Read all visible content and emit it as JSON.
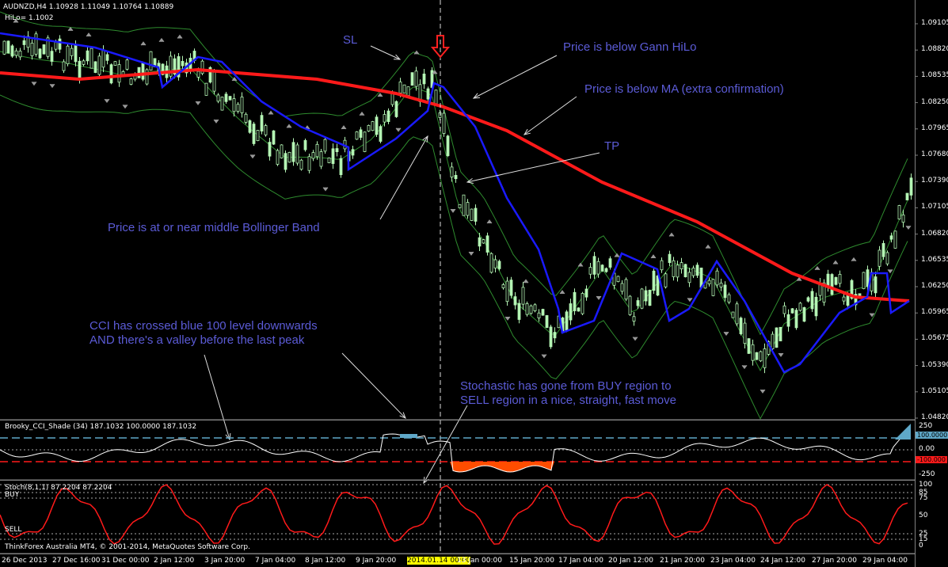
{
  "header": {
    "symbol_info": "AUDNZD,H4  1.10928 1.11049 1.10764 1.10889",
    "hilo_label": "HiLo= 1.1002"
  },
  "annotations": {
    "sl": "SL",
    "gann": "Price is below Gann HiLo",
    "ma": "Price is below MA (extra confirmation)",
    "tp": "TP",
    "bollinger": "Price is at or near middle Bollinger Band",
    "cci_line1": "CCI has crossed blue 100 level downwards",
    "cci_line2": "AND there's a valley before the last peak",
    "stoch_line1": "Stochastic has gone from BUY region to",
    "stoch_line2": "SELL region in a nice, straight, fast move"
  },
  "price_axis": [
    "1.09105",
    "1.08820",
    "1.08535",
    "1.08250",
    "1.07965",
    "1.07680",
    "1.07390",
    "1.07105",
    "1.06820",
    "1.06535",
    "1.06250",
    "1.05965",
    "1.05675",
    "1.05390",
    "1.05105",
    "1.04820"
  ],
  "cci": {
    "label": "Brooky_CCI_Shade (34) 187.1032 100.0000 187.1032",
    "axis": [
      "250",
      "0.00",
      "-250"
    ],
    "badge_upper": "100.0000",
    "badge_lower": "-100.000"
  },
  "stoch": {
    "label": "Stoch(8,1,1) 87.2204 87.2204",
    "buy": "BUY",
    "sell": "SELL",
    "axis": [
      "100",
      "85",
      "75",
      "50",
      "25",
      "15",
      "0"
    ]
  },
  "footer": {
    "copyright": "ThinkForex Australia MT4, © 2001-2014, MetaQuotes Software Corp."
  },
  "time_axis": [
    "26 Dec 2013",
    "27 Dec 16:00",
    "31 Dec 00:00",
    "2 Jan 12:00",
    "3 Jan 20:00",
    "7 Jan 04:00",
    "8 Jan 12:00",
    "9 Jan 20:00",
    "2014.01.14 00:00",
    "13 Jan 00:00",
    "15 Jan 20:00",
    "17 Jan 04:00",
    "20 Jan 12:00",
    "21 Jan 20:00",
    "23 Jan 04:00",
    "24 Jan 12:00",
    "27 Jan 20:00",
    "29 Jan 04:00"
  ],
  "colors": {
    "ma": "#ff1a1a",
    "gann": "#1a1aff",
    "bollinger": "#2e8b2e",
    "candle": "#b5f5b5",
    "cci_fill": "#ff4d00",
    "stoch": "#ff1a1a",
    "annotation": "#5b5bd6",
    "highlight": "#ffff00"
  }
}
